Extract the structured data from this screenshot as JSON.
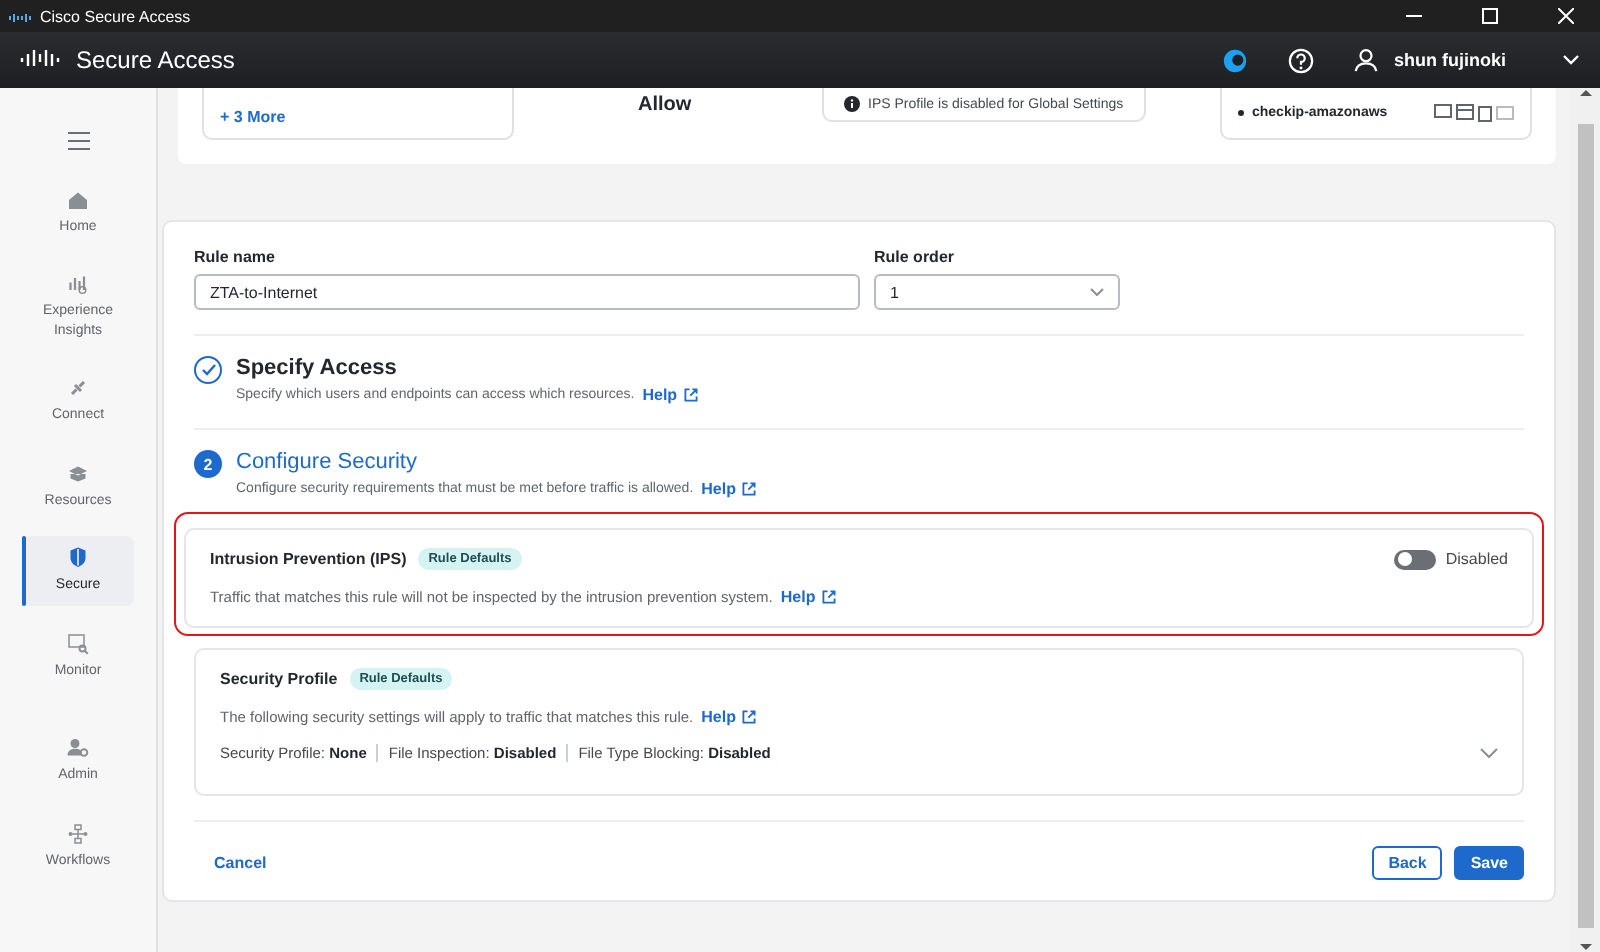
{
  "window": {
    "title": "Cisco Secure Access"
  },
  "header": {
    "product": "Secure Access",
    "user": "shun fujinoki"
  },
  "sidebar": {
    "items": [
      {
        "label": "Home",
        "selected": false
      },
      {
        "label": "Experience Insights",
        "selected": false
      },
      {
        "label": "Connect",
        "selected": false
      },
      {
        "label": "Resources",
        "selected": false
      },
      {
        "label": "Secure",
        "selected": true
      },
      {
        "label": "Monitor",
        "selected": false
      },
      {
        "label": "Admin",
        "selected": false
      },
      {
        "label": "Workflows",
        "selected": false
      }
    ]
  },
  "summary": {
    "more_link": "+ 3 More",
    "action": "Allow",
    "ips_note": "IPS Profile is disabled for Global Settings",
    "destination": "checkip-amazonaws"
  },
  "form": {
    "rule_name": {
      "label": "Rule name",
      "value": "ZTA-to-Internet"
    },
    "rule_order": {
      "label": "Rule order",
      "value": "1"
    }
  },
  "steps": [
    {
      "kind": "done",
      "title": "Specify Access",
      "description": "Specify which users and endpoints can access which resources.",
      "help": "Help"
    },
    {
      "kind": "current",
      "number": "2",
      "title": "Configure Security",
      "description": "Configure security requirements that must be met before traffic is allowed.",
      "help": "Help"
    }
  ],
  "ips": {
    "title": "Intrusion Prevention (IPS)",
    "badge": "Rule Defaults",
    "on": false,
    "status": "Disabled",
    "description": "Traffic that matches this rule will not be inspected by the intrusion prevention system.",
    "help": "Help",
    "highlighted": true
  },
  "security_profile": {
    "title": "Security Profile",
    "badge": "Rule Defaults",
    "description": "The following security settings will apply to traffic that matches this rule.",
    "help": "Help",
    "expanded": false,
    "settings": [
      {
        "label": "Security Profile:",
        "value": "None"
      },
      {
        "label": "File Inspection:",
        "value": "Disabled"
      },
      {
        "label": "File Type Blocking:",
        "value": "Disabled"
      }
    ]
  },
  "footer": {
    "cancel": "Cancel",
    "back": "Back",
    "save": "Save"
  }
}
